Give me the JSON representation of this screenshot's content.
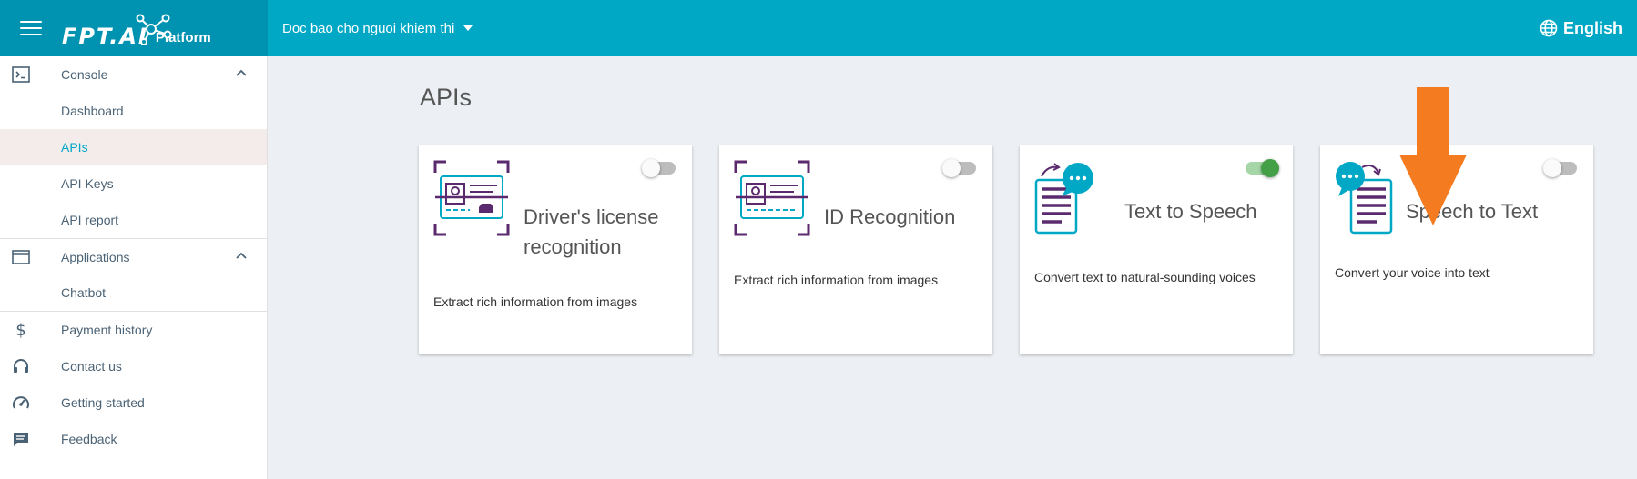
{
  "header": {
    "logo_text": "FPT.AI",
    "logo_sub": "Platform",
    "project": "Doc bao cho nguoi khiem thi",
    "language": "English"
  },
  "sidebar": {
    "console": "Console",
    "dashboard": "Dashboard",
    "apis": "APIs",
    "api_keys": "API Keys",
    "api_report": "API report",
    "applications": "Applications",
    "chatbot": "Chatbot",
    "payment_history": "Payment history",
    "contact_us": "Contact us",
    "getting_started": "Getting started",
    "feedback": "Feedback"
  },
  "main": {
    "title": "APIs",
    "cards": [
      {
        "title_line1": "Driver's license",
        "title_line2": "recognition",
        "desc": "Extract rich information from images",
        "enabled": false
      },
      {
        "title_line1": "ID Recognition",
        "desc": "Extract rich information from images",
        "enabled": false
      },
      {
        "title_line1": "Text to Speech",
        "desc": "Convert text to natural-sounding voices",
        "enabled": true
      },
      {
        "title_line1": "Speech to Text",
        "desc": "Convert your voice into text",
        "enabled": false
      }
    ]
  },
  "colors": {
    "header": "#00a8c6",
    "accent": "#00a8c6",
    "toggle_on": "#43a047",
    "arrow": "#f47b20",
    "icon_purple": "#5b2a6e",
    "icon_teal": "#00a8c6"
  }
}
